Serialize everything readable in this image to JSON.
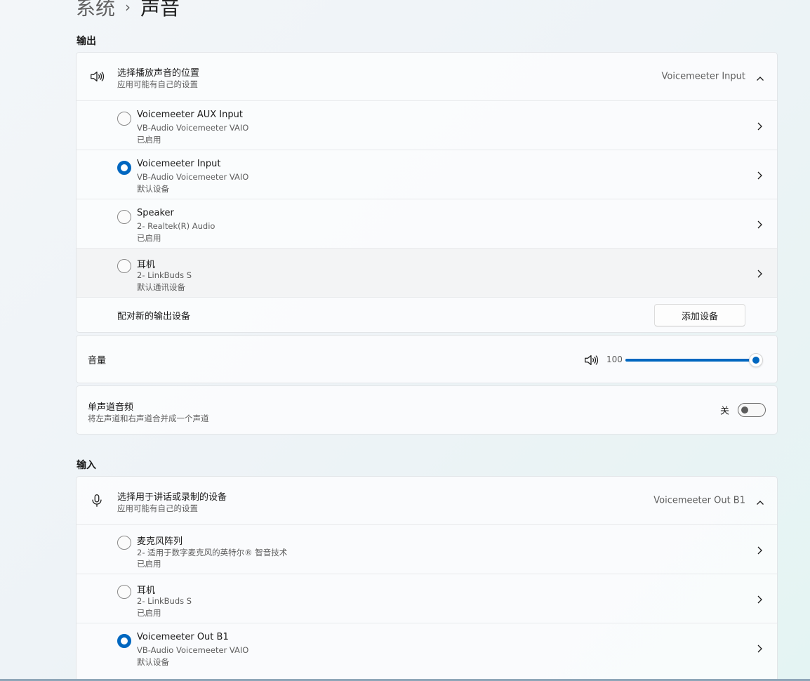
{
  "breadcrumb": {
    "parent": "系统",
    "separator": "›",
    "current": "声音"
  },
  "output": {
    "section_label": "输出",
    "header": {
      "title": "选择播放声音的位置",
      "subtitle": "应用可能有自己的设置",
      "value": "Voicemeeter Input",
      "icon": "speaker-icon",
      "expanded": true
    },
    "devices": [
      {
        "name": "Voicemeeter AUX Input",
        "line2": "VB-Audio Voicemeeter VAIO",
        "line3": "已启用",
        "selected": false
      },
      {
        "name": "Voicemeeter Input",
        "line2": "VB-Audio Voicemeeter VAIO",
        "line3": "默认设备",
        "selected": true
      },
      {
        "name": "Speaker",
        "line2": "2- Realtek(R) Audio",
        "line3": "已启用",
        "selected": false
      },
      {
        "name": "耳机",
        "line2": "2- LinkBuds S",
        "line3": "默认通讯设备",
        "selected": false
      }
    ],
    "pair": {
      "label": "配对新的输出设备",
      "button": "添加设备"
    }
  },
  "volume": {
    "label": "音量",
    "value": "100",
    "level": 1.0,
    "icon": "speaker-icon"
  },
  "mono": {
    "title": "单声道音频",
    "subtitle": "将左声道和右声道合并成一个声道",
    "state_text": "关",
    "on": false
  },
  "input": {
    "section_label": "输入",
    "header": {
      "title": "选择用于讲话或录制的设备",
      "subtitle": "应用可能有自己的设置",
      "value": "Voicemeeter Out B1",
      "icon": "microphone-icon",
      "expanded": true
    },
    "devices": [
      {
        "name": "麦克风阵列",
        "line2": "2- 适用于数字麦克风的英特尔® 智音技术",
        "line3": "已启用",
        "selected": false
      },
      {
        "name": "耳机",
        "line2": "2- LinkBuds S",
        "line3": "已启用",
        "selected": false
      },
      {
        "name": "Voicemeeter Out B1",
        "line2": "VB-Audio Voicemeeter VAIO",
        "line3": "默认设备",
        "selected": true
      }
    ]
  },
  "colors": {
    "accent": "#0067c0",
    "text_primary": "#1b1b1b",
    "text_secondary": "#5d5d5d"
  }
}
